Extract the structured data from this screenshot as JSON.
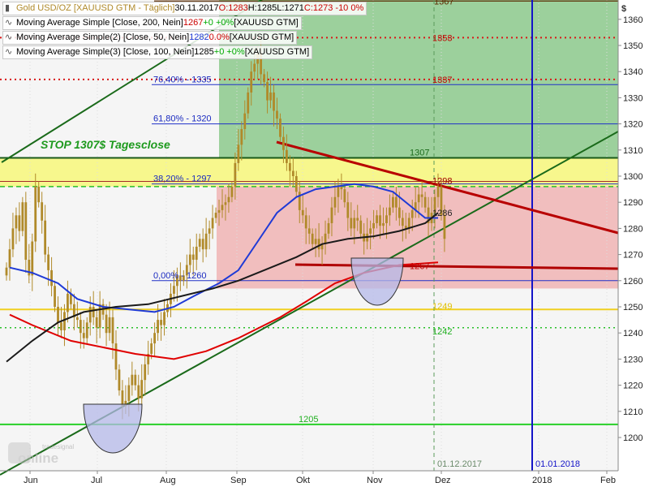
{
  "legend": {
    "main": {
      "name": "Gold USD/OZ [XAUUSD GTM - Täglich]",
      "date": "30.11.2017",
      "open": "O:1283",
      "high": "H:1285",
      "low": "L:1271",
      "close": "C:1273 -10 0%"
    },
    "ma200": {
      "name": "Moving Average Simple [Close, 200, Nein]",
      "value": "1267",
      "change": "+0 +0%",
      "ticker": "[XAUUSD GTM]"
    },
    "ma50": {
      "name": "Moving Average Simple(2) [Close, 50, Nein]",
      "value": "1282",
      "change": "0.0%",
      "ticker": "[XAUUSD GTM]"
    },
    "ma100": {
      "name": "Moving Average Simple(3) [Close, 100, Nein]",
      "value": "1285",
      "change": "+0 +0%",
      "ticker": "[XAUUSD GTM]"
    }
  },
  "annotations": {
    "stop_text": "STOP 1307$ Tagesclose",
    "fib_764": "76,40% - 1335",
    "fib_618": "61,80% - 1320",
    "fib_382": "38,20% - 1297",
    "fib_0": "0,00% - 1260",
    "vline_dec": "01.12.2017",
    "vline_2018": "01.01.2018",
    "watermark_small": "tradesignal",
    "watermark_big": "online"
  },
  "colors": {
    "green_zone": "#8cc98c",
    "yellow_zone": "#f7f77a",
    "red_zone": "#f0b4b4",
    "bg": "#f5f5f5",
    "candle": "#b08a2a",
    "ma200": "#e00000",
    "ma50": "#1f3ad6",
    "ma100": "#1a1a1a",
    "uptrend": "#0a7a0a",
    "downtrend": "#b00000",
    "blue_vline": "#1414c8"
  },
  "chart_data": {
    "type": "candlestick",
    "title": "Gold USD/OZ [XAUUSD GTM - Täglich]",
    "ylim": [
      1195,
      1376
    ],
    "y_ticks": [
      1200,
      1210,
      1220,
      1230,
      1240,
      1250,
      1260,
      1270,
      1280,
      1290,
      1300,
      1310,
      1320,
      1330,
      1340,
      1350,
      1360
    ],
    "x_ticks": [
      "Jun",
      "Jul",
      "Aug",
      "Sep",
      "Okt",
      "Nov",
      "Dez",
      "2018",
      "Feb"
    ],
    "y_axis_symbol": "$",
    "levels": [
      {
        "value": 1367,
        "label": "1367",
        "style": "solid"
      },
      {
        "value": 1353,
        "label": "1353",
        "style": "dotted"
      },
      {
        "value": 1337,
        "label": "1337",
        "style": "dotted"
      },
      {
        "value": 1307,
        "label": "1307",
        "style": "solid"
      },
      {
        "value": 1298,
        "label": "1298",
        "style": "solid"
      },
      {
        "value": 1296,
        "label": "",
        "style": "dashed"
      },
      {
        "value": 1286,
        "label": "1286",
        "style": "label"
      },
      {
        "value": 1267,
        "label": "1267",
        "style": "label"
      },
      {
        "value": 1249,
        "label": "1249",
        "style": "solid"
      },
      {
        "value": 1242,
        "label": "1242",
        "style": "dotted"
      },
      {
        "value": 1205,
        "label": "1205",
        "style": "solid"
      }
    ],
    "fibonacci": [
      {
        "value": 1335,
        "label": "76,40% - 1335"
      },
      {
        "value": 1320,
        "label": "61,80% - 1320"
      },
      {
        "value": 1297,
        "label": "38,20% - 1297"
      },
      {
        "value": 1260,
        "label": "0,00% - 1260"
      }
    ],
    "zones": [
      {
        "name": "green",
        "from": 1307,
        "to": 1375
      },
      {
        "name": "yellow",
        "from": 1296,
        "to": 1307
      },
      {
        "name": "red",
        "from": 1257,
        "to": 1296
      }
    ],
    "series": [
      {
        "name": "Gold USD/OZ",
        "type": "candlestick",
        "close": [
          1265,
          1272,
          1280,
          1285,
          1279,
          1290,
          1268,
          1262,
          1275,
          1296,
          1290,
          1283,
          1270,
          1264,
          1258,
          1250,
          1244,
          1241,
          1248,
          1255,
          1251,
          1246,
          1245,
          1240,
          1238,
          1244,
          1250,
          1246,
          1242,
          1251,
          1247,
          1240,
          1246,
          1236,
          1226,
          1218,
          1212,
          1214,
          1220,
          1224,
          1220,
          1215,
          1222,
          1228,
          1232,
          1236,
          1240,
          1245,
          1243,
          1248,
          1251,
          1255,
          1258,
          1262,
          1260,
          1262,
          1266,
          1270,
          1268,
          1273,
          1276,
          1272,
          1278,
          1280,
          1284,
          1286,
          1287,
          1289,
          1290,
          1292,
          1296,
          1305,
          1312,
          1318,
          1324,
          1332,
          1340,
          1343,
          1347,
          1339,
          1336,
          1329,
          1332,
          1325,
          1322,
          1315,
          1310,
          1305,
          1302,
          1300,
          1294,
          1287,
          1285,
          1280,
          1278,
          1274,
          1276,
          1272,
          1274,
          1278,
          1282,
          1288,
          1292,
          1296,
          1295,
          1290,
          1284,
          1280,
          1284,
          1283,
          1278,
          1275,
          1278,
          1280,
          1282,
          1285,
          1281,
          1282,
          1285,
          1288,
          1292,
          1288,
          1284,
          1281,
          1280,
          1284,
          1287,
          1290,
          1293,
          1292,
          1288,
          1282,
          1286,
          1292,
          1296,
          1285,
          1276
        ]
      },
      {
        "name": "MA 200",
        "type": "line",
        "points": [
          [
            1,
            1247
          ],
          [
            8,
            1243
          ],
          [
            20,
            1237
          ],
          [
            40,
            1232
          ],
          [
            52,
            1230
          ],
          [
            62,
            1233
          ],
          [
            72,
            1238
          ],
          [
            85,
            1246
          ],
          [
            93,
            1252
          ],
          [
            102,
            1259
          ],
          [
            111,
            1263
          ],
          [
            122,
            1266
          ],
          [
            134,
            1267
          ]
        ]
      },
      {
        "name": "MA 50",
        "type": "line",
        "points": [
          [
            1,
            1265
          ],
          [
            8,
            1263
          ],
          [
            16,
            1259
          ],
          [
            22,
            1253
          ],
          [
            30,
            1250
          ],
          [
            38,
            1249
          ],
          [
            46,
            1248
          ],
          [
            52,
            1250
          ],
          [
            58,
            1254
          ],
          [
            66,
            1259
          ],
          [
            72,
            1264
          ],
          [
            78,
            1275
          ],
          [
            84,
            1286
          ],
          [
            90,
            1292
          ],
          [
            96,
            1295
          ],
          [
            102,
            1296
          ],
          [
            108,
            1297
          ],
          [
            114,
            1296
          ],
          [
            120,
            1294
          ],
          [
            126,
            1288
          ],
          [
            130,
            1284
          ],
          [
            134,
            1284
          ]
        ]
      },
      {
        "name": "MA 100",
        "type": "line",
        "points": [
          [
            0,
            1229
          ],
          [
            8,
            1237
          ],
          [
            16,
            1244
          ],
          [
            24,
            1248
          ],
          [
            34,
            1250
          ],
          [
            44,
            1251
          ],
          [
            54,
            1254
          ],
          [
            64,
            1257
          ],
          [
            72,
            1260
          ],
          [
            80,
            1264
          ],
          [
            90,
            1269
          ],
          [
            98,
            1274
          ],
          [
            106,
            1276
          ],
          [
            114,
            1277
          ],
          [
            122,
            1279
          ],
          [
            130,
            1282
          ],
          [
            134,
            1286
          ]
        ]
      }
    ],
    "trendlines": [
      {
        "name": "long uptrend",
        "color": "green"
      },
      {
        "name": "short uptrend",
        "color": "green"
      },
      {
        "name": "downtrend",
        "color": "red"
      },
      {
        "name": "support",
        "color": "red"
      }
    ]
  }
}
